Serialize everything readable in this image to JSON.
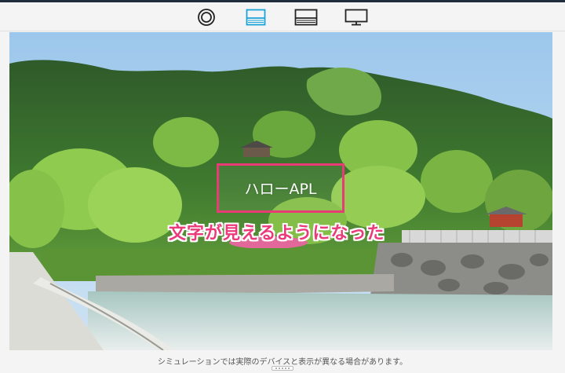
{
  "toolbar": {
    "tools": [
      {
        "icon": "circle-target-icon",
        "selected": false
      },
      {
        "icon": "layout-top-panel-icon",
        "selected": true
      },
      {
        "icon": "layout-bottom-panel-icon",
        "selected": false
      },
      {
        "icon": "monitor-icon",
        "selected": false
      }
    ],
    "accent_color": "#1aa3d9"
  },
  "preview": {
    "label_text": "ハローAPL",
    "label_border_color": "#e83a75",
    "annotation_text": "文字が見えるようになった",
    "annotation_color": "#ea3a7a"
  },
  "footer": {
    "note": "シミュレーションでは実際のデバイスと表示が異なる場合があります。"
  }
}
